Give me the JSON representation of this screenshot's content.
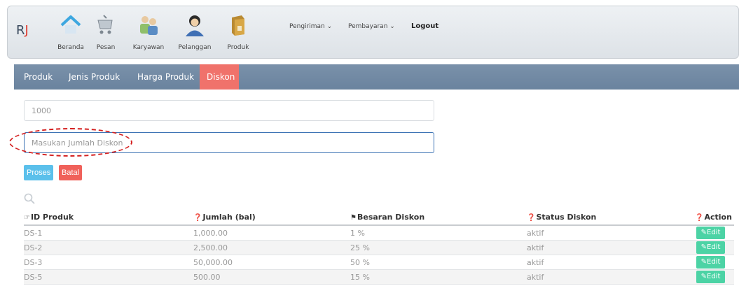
{
  "brand": {
    "letter1": "R",
    "letter2": "J"
  },
  "nav": {
    "items": [
      {
        "label": "Beranda",
        "icon": "home-icon"
      },
      {
        "label": "Pesan",
        "icon": "cart-icon"
      },
      {
        "label": "Karyawan",
        "icon": "employees-icon"
      },
      {
        "label": "Pelanggan",
        "icon": "customer-icon"
      },
      {
        "label": "Produk",
        "icon": "product-box-icon"
      }
    ],
    "dropdowns": [
      "Pengiriman ⌄",
      "Pembayaran ⌄"
    ],
    "logout": "Logout"
  },
  "tabs": [
    "Produk",
    "Jenis Produk",
    "Harga Produk",
    "Diskon"
  ],
  "active_tab": "Diskon",
  "form": {
    "amount_value": "1000",
    "discount_placeholder": "Masukan Jumlah Diskon",
    "submit_label": "Proses",
    "cancel_label": "Batal"
  },
  "table": {
    "headers": [
      "ID Produk",
      "Jumlah (bal)",
      "Besaran Diskon",
      "Status Diskon",
      "Action"
    ],
    "header_icons": [
      "bullhorn-icon",
      "info-circle-icon",
      "bookmark-icon",
      "question-circle-icon",
      "question-circle-icon"
    ],
    "rows": [
      {
        "id": "DS-1",
        "jumlah": "1,000.00",
        "besaran": "1 %",
        "status": "aktif",
        "action": "Edit"
      },
      {
        "id": "DS-2",
        "jumlah": "2,500.00",
        "besaran": "25 %",
        "status": "aktif",
        "action": "Edit"
      },
      {
        "id": "DS-3",
        "jumlah": "50,000.00",
        "besaran": "50 %",
        "status": "aktif",
        "action": "Edit"
      },
      {
        "id": "DS-5",
        "jumlah": "500.00",
        "besaran": "15 %",
        "status": "aktif",
        "action": "Edit"
      }
    ]
  },
  "colors": {
    "tabbar": "#6f87a2",
    "active_tab": "#f0726b",
    "proses": "#5bc0eb",
    "batal": "#f0615a",
    "edit": "#4cd3a5"
  }
}
